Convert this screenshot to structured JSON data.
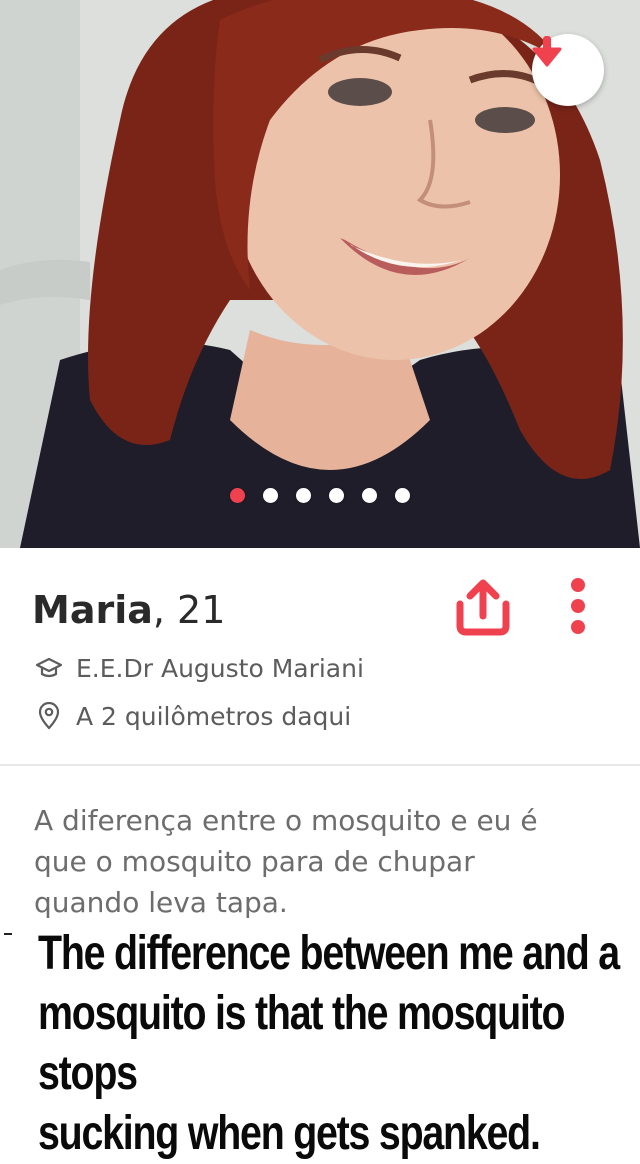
{
  "profile": {
    "name": "Maria",
    "age_text": ", 21",
    "school": "E.E.Dr Augusto Mariani",
    "distance": "A 2 quilômetros daqui",
    "bio": "A diferença entre o mosquito e eu é\nque o mosquito para de chupar\nquando leva tapa."
  },
  "photo": {
    "count": 6,
    "active_index": 0,
    "description_icon": "profile-photo"
  },
  "actions": {
    "save_icon": "arrow-down-icon",
    "share_icon": "share-upload-icon",
    "more_icon": "more-vertical-icon"
  },
  "caption": {
    "text": "The difference between me and a\nmosquito is that the mosquito stops\nsucking when gets spanked."
  },
  "colors": {
    "accent": "#f0414f",
    "name_text": "#2a2a2a",
    "meta_text": "#5c5c5c",
    "bio_text": "#6d6d6d"
  }
}
